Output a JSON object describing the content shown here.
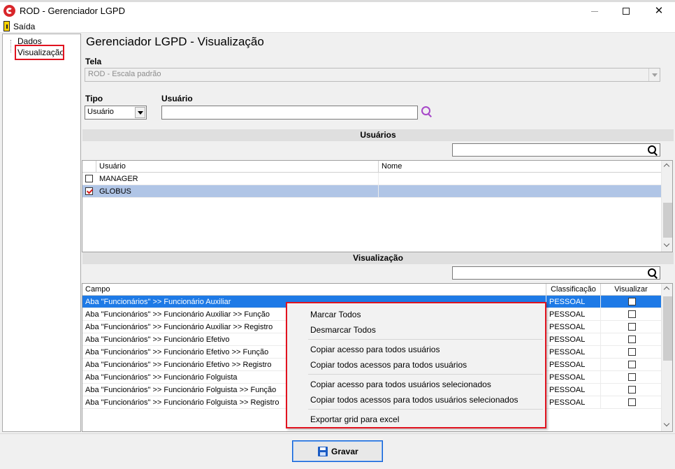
{
  "window": {
    "title": "ROD - Gerenciador LGPD",
    "minimize": "—",
    "maximize": "",
    "close": "✕"
  },
  "menu": {
    "exit_label": "Saída"
  },
  "sidebar": {
    "items": [
      {
        "label": "Dados"
      },
      {
        "label": "Visualização"
      }
    ]
  },
  "page": {
    "title": "Gerenciador LGPD - Visualização",
    "tela_label": "Tela",
    "tela_value": "ROD - Escala padrão",
    "tipo_label": "Tipo",
    "tipo_value": "Usuário",
    "usuario_label": "Usuário",
    "usuario_value": ""
  },
  "usuarios": {
    "header": "Usuários",
    "search_value": "",
    "columns": [
      "Usuário",
      "Nome"
    ],
    "rows": [
      {
        "usuario": "MANAGER",
        "nome": "",
        "checked": false
      },
      {
        "usuario": "GLOBUS",
        "nome": "",
        "checked": true
      }
    ]
  },
  "visualizacao": {
    "header": "Visualização",
    "search_value": "",
    "columns": [
      "Campo",
      "Classificação",
      "Visualizar"
    ],
    "rows": [
      {
        "campo": "Aba \"Funcionários\" >> Funcionário Auxiliar",
        "classificacao": "PESSOAL"
      },
      {
        "campo": "Aba \"Funcionários\" >> Funcionário Auxiliar >> Função",
        "classificacao": "PESSOAL"
      },
      {
        "campo": "Aba \"Funcionários\" >> Funcionário Auxiliar >> Registro",
        "classificacao": "PESSOAL"
      },
      {
        "campo": "Aba \"Funcionários\" >> Funcionário Efetivo",
        "classificacao": "PESSOAL"
      },
      {
        "campo": "Aba \"Funcionários\" >> Funcionário Efetivo >> Função",
        "classificacao": "PESSOAL"
      },
      {
        "campo": "Aba \"Funcionários\" >> Funcionário Efetivo >> Registro",
        "classificacao": "PESSOAL"
      },
      {
        "campo": "Aba \"Funcionários\" >> Funcionário Folguista",
        "classificacao": "PESSOAL"
      },
      {
        "campo": "Aba \"Funcionários\" >> Funcionário Folguista >> Função",
        "classificacao": "PESSOAL"
      },
      {
        "campo": "Aba \"Funcionários\" >> Funcionário Folguista >> Registro",
        "classificacao": "PESSOAL"
      }
    ]
  },
  "context_menu": {
    "items": [
      "Marcar Todos",
      "Desmarcar Todos",
      "Copiar acesso para todos usuários",
      "Copiar todos acessos para todos usuários",
      "Copiar acesso para todos usuários selecionados",
      "Copiar todos acessos para todos usuários selecionados",
      "Exportar grid para excel"
    ]
  },
  "footer": {
    "save_label": "Gravar"
  },
  "colors": {
    "selection_blue": "#1e7ae6",
    "selection_light": "#b0c5e6",
    "highlight_red": "#e1131f",
    "save_icon_blue": "#1a5bc4"
  }
}
